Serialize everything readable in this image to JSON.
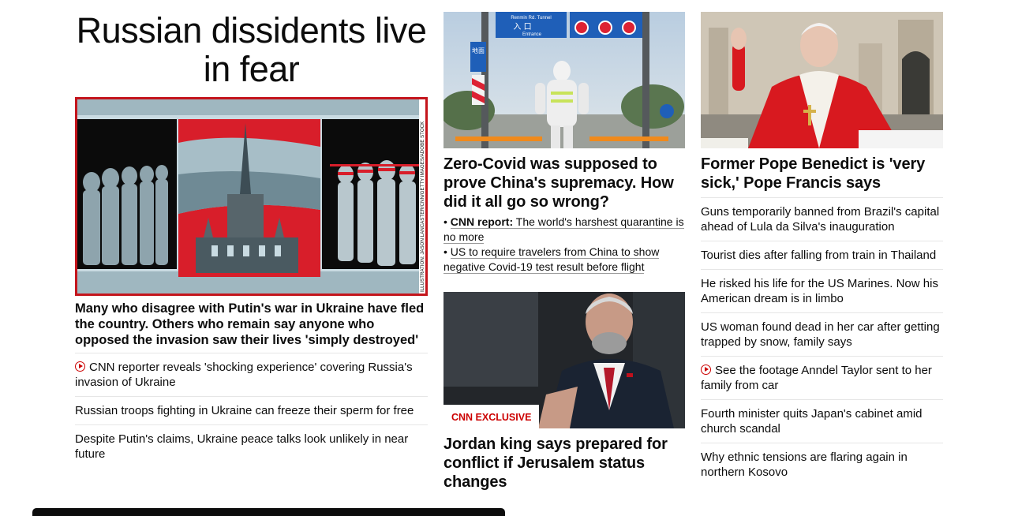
{
  "left": {
    "hero_title": "Russian dissidents live in fear",
    "image_credit": "ILLUSTRATION: JASON LANCASTER/CNN/GETTY IMAGES/ADOBE STOCK",
    "caption": "Many who disagree with Putin's war in Ukraine have fled the country. Others who remain say anyone who opposed the invasion saw their lives 'simply destroyed'",
    "links": [
      {
        "text": "CNN reporter reveals 'shocking experience' covering Russia's invasion of Ukraine",
        "video": true
      },
      {
        "text": "Russian troops fighting in Ukraine can freeze their sperm for free",
        "video": false
      },
      {
        "text": "Despite Putin's claims, Ukraine peace talks look unlikely in near future",
        "video": false
      }
    ]
  },
  "middle": {
    "story1": {
      "sign_text_1": "Renmin Rd. Tunnel",
      "sign_text_2": "入 口",
      "sign_text_3": "Entrance",
      "sign_text_4": "地面",
      "headline": "Zero-Covid was supposed to prove China's supremacy. How did it all go so wrong?",
      "sub_links": [
        {
          "prefix": "CNN report:",
          "text": "The world's harshest quarantine is no more"
        },
        {
          "prefix": "",
          "text": "US to require travelers from China to show negative Covid-19 test result before flight"
        }
      ]
    },
    "story2": {
      "badge": "CNN EXCLUSIVE",
      "headline": "Jordan king says prepared for conflict if Jerusalem status changes"
    }
  },
  "right": {
    "headline": "Former Pope Benedict is 'very sick,' Pope Francis says",
    "links": [
      {
        "text": "Guns temporarily banned from Brazil's capital ahead of Lula da Silva's inauguration",
        "video": false
      },
      {
        "text": "Tourist dies after falling from train in Thailand",
        "video": false
      },
      {
        "text": "He risked his life for the US Marines. Now his American dream is in limbo",
        "video": false
      },
      {
        "text": "US woman found dead in her car after getting trapped by snow, family says",
        "video": false
      },
      {
        "text": "See the footage Anndel Taylor sent to her family from car",
        "video": true
      },
      {
        "text": "Fourth minister quits Japan's cabinet amid church scandal",
        "video": false
      },
      {
        "text": "Why ethnic tensions are flaring again in northern Kosovo",
        "video": false
      }
    ]
  },
  "colors": {
    "accent_red": "#cc0000",
    "text": "#0c0c0c",
    "divider": "#e6e6e6"
  }
}
